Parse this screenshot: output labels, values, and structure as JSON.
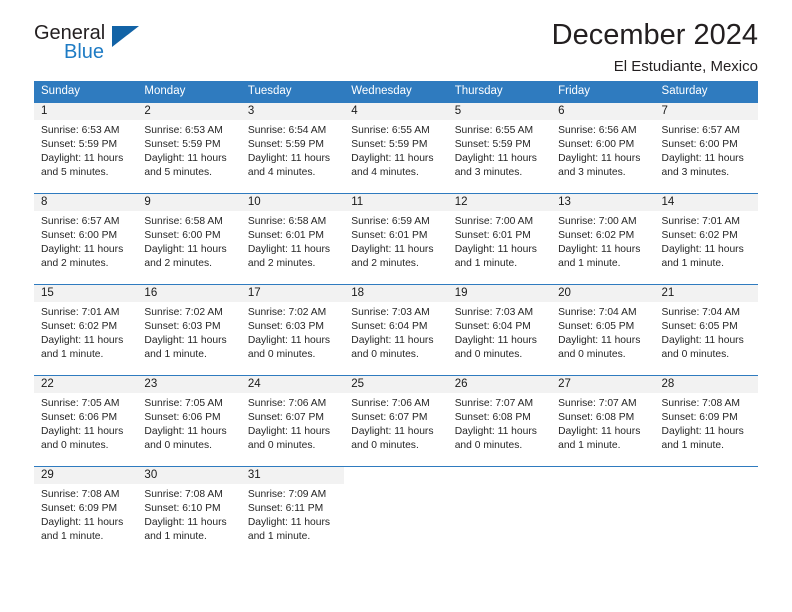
{
  "brand": {
    "name_part1": "General",
    "name_part2": "Blue",
    "triangle_color": "#1263a6",
    "blue_color": "#1e7bc4"
  },
  "header": {
    "title": "December 2024",
    "location": "El Estudiante, Mexico"
  },
  "theme": {
    "header_row_bg": "#2f7bbf",
    "daynum_band_bg": "#f2f2f2",
    "grid_line": "#2f7bbf",
    "text": "#262626"
  },
  "weekday_headers": [
    "Sunday",
    "Monday",
    "Tuesday",
    "Wednesday",
    "Thursday",
    "Friday",
    "Saturday"
  ],
  "weeks": [
    [
      {
        "day": "1",
        "sunrise": "Sunrise: 6:53 AM",
        "sunset": "Sunset: 5:59 PM",
        "daylight1": "Daylight: 11 hours",
        "daylight2": "and 5 minutes."
      },
      {
        "day": "2",
        "sunrise": "Sunrise: 6:53 AM",
        "sunset": "Sunset: 5:59 PM",
        "daylight1": "Daylight: 11 hours",
        "daylight2": "and 5 minutes."
      },
      {
        "day": "3",
        "sunrise": "Sunrise: 6:54 AM",
        "sunset": "Sunset: 5:59 PM",
        "daylight1": "Daylight: 11 hours",
        "daylight2": "and 4 minutes."
      },
      {
        "day": "4",
        "sunrise": "Sunrise: 6:55 AM",
        "sunset": "Sunset: 5:59 PM",
        "daylight1": "Daylight: 11 hours",
        "daylight2": "and 4 minutes."
      },
      {
        "day": "5",
        "sunrise": "Sunrise: 6:55 AM",
        "sunset": "Sunset: 5:59 PM",
        "daylight1": "Daylight: 11 hours",
        "daylight2": "and 3 minutes."
      },
      {
        "day": "6",
        "sunrise": "Sunrise: 6:56 AM",
        "sunset": "Sunset: 6:00 PM",
        "daylight1": "Daylight: 11 hours",
        "daylight2": "and 3 minutes."
      },
      {
        "day": "7",
        "sunrise": "Sunrise: 6:57 AM",
        "sunset": "Sunset: 6:00 PM",
        "daylight1": "Daylight: 11 hours",
        "daylight2": "and 3 minutes."
      }
    ],
    [
      {
        "day": "8",
        "sunrise": "Sunrise: 6:57 AM",
        "sunset": "Sunset: 6:00 PM",
        "daylight1": "Daylight: 11 hours",
        "daylight2": "and 2 minutes."
      },
      {
        "day": "9",
        "sunrise": "Sunrise: 6:58 AM",
        "sunset": "Sunset: 6:00 PM",
        "daylight1": "Daylight: 11 hours",
        "daylight2": "and 2 minutes."
      },
      {
        "day": "10",
        "sunrise": "Sunrise: 6:58 AM",
        "sunset": "Sunset: 6:01 PM",
        "daylight1": "Daylight: 11 hours",
        "daylight2": "and 2 minutes."
      },
      {
        "day": "11",
        "sunrise": "Sunrise: 6:59 AM",
        "sunset": "Sunset: 6:01 PM",
        "daylight1": "Daylight: 11 hours",
        "daylight2": "and 2 minutes."
      },
      {
        "day": "12",
        "sunrise": "Sunrise: 7:00 AM",
        "sunset": "Sunset: 6:01 PM",
        "daylight1": "Daylight: 11 hours",
        "daylight2": "and 1 minute."
      },
      {
        "day": "13",
        "sunrise": "Sunrise: 7:00 AM",
        "sunset": "Sunset: 6:02 PM",
        "daylight1": "Daylight: 11 hours",
        "daylight2": "and 1 minute."
      },
      {
        "day": "14",
        "sunrise": "Sunrise: 7:01 AM",
        "sunset": "Sunset: 6:02 PM",
        "daylight1": "Daylight: 11 hours",
        "daylight2": "and 1 minute."
      }
    ],
    [
      {
        "day": "15",
        "sunrise": "Sunrise: 7:01 AM",
        "sunset": "Sunset: 6:02 PM",
        "daylight1": "Daylight: 11 hours",
        "daylight2": "and 1 minute."
      },
      {
        "day": "16",
        "sunrise": "Sunrise: 7:02 AM",
        "sunset": "Sunset: 6:03 PM",
        "daylight1": "Daylight: 11 hours",
        "daylight2": "and 1 minute."
      },
      {
        "day": "17",
        "sunrise": "Sunrise: 7:02 AM",
        "sunset": "Sunset: 6:03 PM",
        "daylight1": "Daylight: 11 hours",
        "daylight2": "and 0 minutes."
      },
      {
        "day": "18",
        "sunrise": "Sunrise: 7:03 AM",
        "sunset": "Sunset: 6:04 PM",
        "daylight1": "Daylight: 11 hours",
        "daylight2": "and 0 minutes."
      },
      {
        "day": "19",
        "sunrise": "Sunrise: 7:03 AM",
        "sunset": "Sunset: 6:04 PM",
        "daylight1": "Daylight: 11 hours",
        "daylight2": "and 0 minutes."
      },
      {
        "day": "20",
        "sunrise": "Sunrise: 7:04 AM",
        "sunset": "Sunset: 6:05 PM",
        "daylight1": "Daylight: 11 hours",
        "daylight2": "and 0 minutes."
      },
      {
        "day": "21",
        "sunrise": "Sunrise: 7:04 AM",
        "sunset": "Sunset: 6:05 PM",
        "daylight1": "Daylight: 11 hours",
        "daylight2": "and 0 minutes."
      }
    ],
    [
      {
        "day": "22",
        "sunrise": "Sunrise: 7:05 AM",
        "sunset": "Sunset: 6:06 PM",
        "daylight1": "Daylight: 11 hours",
        "daylight2": "and 0 minutes."
      },
      {
        "day": "23",
        "sunrise": "Sunrise: 7:05 AM",
        "sunset": "Sunset: 6:06 PM",
        "daylight1": "Daylight: 11 hours",
        "daylight2": "and 0 minutes."
      },
      {
        "day": "24",
        "sunrise": "Sunrise: 7:06 AM",
        "sunset": "Sunset: 6:07 PM",
        "daylight1": "Daylight: 11 hours",
        "daylight2": "and 0 minutes."
      },
      {
        "day": "25",
        "sunrise": "Sunrise: 7:06 AM",
        "sunset": "Sunset: 6:07 PM",
        "daylight1": "Daylight: 11 hours",
        "daylight2": "and 0 minutes."
      },
      {
        "day": "26",
        "sunrise": "Sunrise: 7:07 AM",
        "sunset": "Sunset: 6:08 PM",
        "daylight1": "Daylight: 11 hours",
        "daylight2": "and 0 minutes."
      },
      {
        "day": "27",
        "sunrise": "Sunrise: 7:07 AM",
        "sunset": "Sunset: 6:08 PM",
        "daylight1": "Daylight: 11 hours",
        "daylight2": "and 1 minute."
      },
      {
        "day": "28",
        "sunrise": "Sunrise: 7:08 AM",
        "sunset": "Sunset: 6:09 PM",
        "daylight1": "Daylight: 11 hours",
        "daylight2": "and 1 minute."
      }
    ],
    [
      {
        "day": "29",
        "sunrise": "Sunrise: 7:08 AM",
        "sunset": "Sunset: 6:09 PM",
        "daylight1": "Daylight: 11 hours",
        "daylight2": "and 1 minute."
      },
      {
        "day": "30",
        "sunrise": "Sunrise: 7:08 AM",
        "sunset": "Sunset: 6:10 PM",
        "daylight1": "Daylight: 11 hours",
        "daylight2": "and 1 minute."
      },
      {
        "day": "31",
        "sunrise": "Sunrise: 7:09 AM",
        "sunset": "Sunset: 6:11 PM",
        "daylight1": "Daylight: 11 hours",
        "daylight2": "and 1 minute."
      },
      {
        "day": "",
        "sunrise": "",
        "sunset": "",
        "daylight1": "",
        "daylight2": ""
      },
      {
        "day": "",
        "sunrise": "",
        "sunset": "",
        "daylight1": "",
        "daylight2": ""
      },
      {
        "day": "",
        "sunrise": "",
        "sunset": "",
        "daylight1": "",
        "daylight2": ""
      },
      {
        "day": "",
        "sunrise": "",
        "sunset": "",
        "daylight1": "",
        "daylight2": ""
      }
    ]
  ]
}
